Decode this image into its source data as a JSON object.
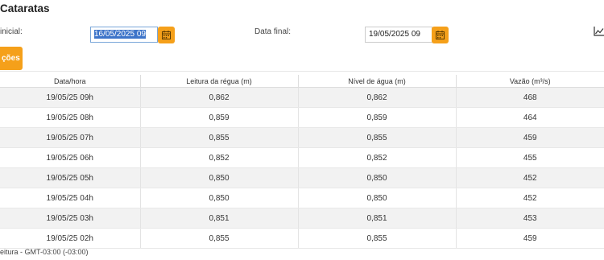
{
  "header": {
    "title": "Cataratas",
    "initial_label": "inicial:",
    "final_label": "Data final:"
  },
  "filters": {
    "initial_value": "16/05/2025 09",
    "final_value": "19/05/2025 09"
  },
  "icons": {
    "calendar": "calendar-icon",
    "chart": "chart-line-icon"
  },
  "colors": {
    "accent": "#f5a01a",
    "selection": "#3d74c9"
  },
  "tab": {
    "label": "ções"
  },
  "table": {
    "headers": [
      "Data/hora",
      "Leitura da régua (m)",
      "Nível de água (m)",
      "Vazão (m³/s)"
    ],
    "rows": [
      [
        "19/05/25 09h",
        "0,862",
        "0,862",
        "468"
      ],
      [
        "19/05/25 08h",
        "0,859",
        "0,859",
        "464"
      ],
      [
        "19/05/25 07h",
        "0,855",
        "0,855",
        "459"
      ],
      [
        "19/05/25 06h",
        "0,852",
        "0,852",
        "455"
      ],
      [
        "19/05/25 05h",
        "0,850",
        "0,850",
        "452"
      ],
      [
        "19/05/25 04h",
        "0,850",
        "0,850",
        "452"
      ],
      [
        "19/05/25 03h",
        "0,851",
        "0,851",
        "453"
      ],
      [
        "19/05/25 02h",
        "0,855",
        "0,855",
        "459"
      ]
    ]
  },
  "footnote": "eitura - GMT-03:00 (-03:00)"
}
